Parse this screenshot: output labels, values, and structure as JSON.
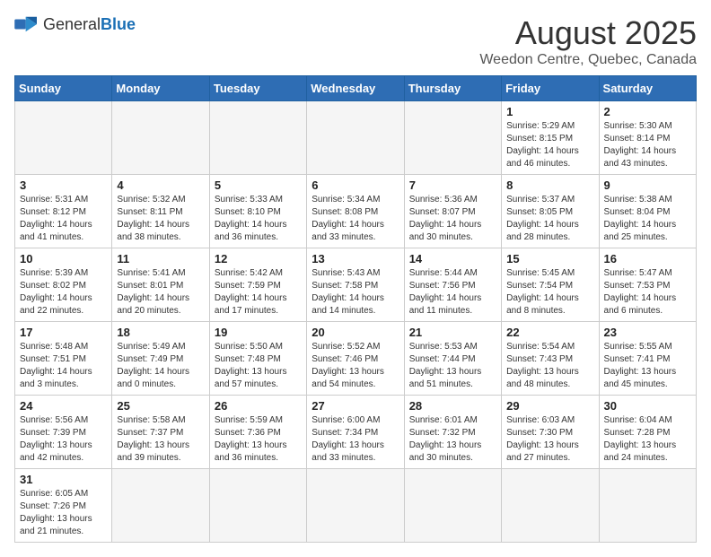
{
  "header": {
    "logo_text_general": "General",
    "logo_text_blue": "Blue",
    "month_title": "August 2025",
    "location": "Weedon Centre, Quebec, Canada"
  },
  "weekdays": [
    "Sunday",
    "Monday",
    "Tuesday",
    "Wednesday",
    "Thursday",
    "Friday",
    "Saturday"
  ],
  "weeks": [
    [
      {
        "day": "",
        "info": ""
      },
      {
        "day": "",
        "info": ""
      },
      {
        "day": "",
        "info": ""
      },
      {
        "day": "",
        "info": ""
      },
      {
        "day": "",
        "info": ""
      },
      {
        "day": "1",
        "info": "Sunrise: 5:29 AM\nSunset: 8:15 PM\nDaylight: 14 hours and 46 minutes."
      },
      {
        "day": "2",
        "info": "Sunrise: 5:30 AM\nSunset: 8:14 PM\nDaylight: 14 hours and 43 minutes."
      }
    ],
    [
      {
        "day": "3",
        "info": "Sunrise: 5:31 AM\nSunset: 8:12 PM\nDaylight: 14 hours and 41 minutes."
      },
      {
        "day": "4",
        "info": "Sunrise: 5:32 AM\nSunset: 8:11 PM\nDaylight: 14 hours and 38 minutes."
      },
      {
        "day": "5",
        "info": "Sunrise: 5:33 AM\nSunset: 8:10 PM\nDaylight: 14 hours and 36 minutes."
      },
      {
        "day": "6",
        "info": "Sunrise: 5:34 AM\nSunset: 8:08 PM\nDaylight: 14 hours and 33 minutes."
      },
      {
        "day": "7",
        "info": "Sunrise: 5:36 AM\nSunset: 8:07 PM\nDaylight: 14 hours and 30 minutes."
      },
      {
        "day": "8",
        "info": "Sunrise: 5:37 AM\nSunset: 8:05 PM\nDaylight: 14 hours and 28 minutes."
      },
      {
        "day": "9",
        "info": "Sunrise: 5:38 AM\nSunset: 8:04 PM\nDaylight: 14 hours and 25 minutes."
      }
    ],
    [
      {
        "day": "10",
        "info": "Sunrise: 5:39 AM\nSunset: 8:02 PM\nDaylight: 14 hours and 22 minutes."
      },
      {
        "day": "11",
        "info": "Sunrise: 5:41 AM\nSunset: 8:01 PM\nDaylight: 14 hours and 20 minutes."
      },
      {
        "day": "12",
        "info": "Sunrise: 5:42 AM\nSunset: 7:59 PM\nDaylight: 14 hours and 17 minutes."
      },
      {
        "day": "13",
        "info": "Sunrise: 5:43 AM\nSunset: 7:58 PM\nDaylight: 14 hours and 14 minutes."
      },
      {
        "day": "14",
        "info": "Sunrise: 5:44 AM\nSunset: 7:56 PM\nDaylight: 14 hours and 11 minutes."
      },
      {
        "day": "15",
        "info": "Sunrise: 5:45 AM\nSunset: 7:54 PM\nDaylight: 14 hours and 8 minutes."
      },
      {
        "day": "16",
        "info": "Sunrise: 5:47 AM\nSunset: 7:53 PM\nDaylight: 14 hours and 6 minutes."
      }
    ],
    [
      {
        "day": "17",
        "info": "Sunrise: 5:48 AM\nSunset: 7:51 PM\nDaylight: 14 hours and 3 minutes."
      },
      {
        "day": "18",
        "info": "Sunrise: 5:49 AM\nSunset: 7:49 PM\nDaylight: 14 hours and 0 minutes."
      },
      {
        "day": "19",
        "info": "Sunrise: 5:50 AM\nSunset: 7:48 PM\nDaylight: 13 hours and 57 minutes."
      },
      {
        "day": "20",
        "info": "Sunrise: 5:52 AM\nSunset: 7:46 PM\nDaylight: 13 hours and 54 minutes."
      },
      {
        "day": "21",
        "info": "Sunrise: 5:53 AM\nSunset: 7:44 PM\nDaylight: 13 hours and 51 minutes."
      },
      {
        "day": "22",
        "info": "Sunrise: 5:54 AM\nSunset: 7:43 PM\nDaylight: 13 hours and 48 minutes."
      },
      {
        "day": "23",
        "info": "Sunrise: 5:55 AM\nSunset: 7:41 PM\nDaylight: 13 hours and 45 minutes."
      }
    ],
    [
      {
        "day": "24",
        "info": "Sunrise: 5:56 AM\nSunset: 7:39 PM\nDaylight: 13 hours and 42 minutes."
      },
      {
        "day": "25",
        "info": "Sunrise: 5:58 AM\nSunset: 7:37 PM\nDaylight: 13 hours and 39 minutes."
      },
      {
        "day": "26",
        "info": "Sunrise: 5:59 AM\nSunset: 7:36 PM\nDaylight: 13 hours and 36 minutes."
      },
      {
        "day": "27",
        "info": "Sunrise: 6:00 AM\nSunset: 7:34 PM\nDaylight: 13 hours and 33 minutes."
      },
      {
        "day": "28",
        "info": "Sunrise: 6:01 AM\nSunset: 7:32 PM\nDaylight: 13 hours and 30 minutes."
      },
      {
        "day": "29",
        "info": "Sunrise: 6:03 AM\nSunset: 7:30 PM\nDaylight: 13 hours and 27 minutes."
      },
      {
        "day": "30",
        "info": "Sunrise: 6:04 AM\nSunset: 7:28 PM\nDaylight: 13 hours and 24 minutes."
      }
    ],
    [
      {
        "day": "31",
        "info": "Sunrise: 6:05 AM\nSunset: 7:26 PM\nDaylight: 13 hours and 21 minutes."
      },
      {
        "day": "",
        "info": ""
      },
      {
        "day": "",
        "info": ""
      },
      {
        "day": "",
        "info": ""
      },
      {
        "day": "",
        "info": ""
      },
      {
        "day": "",
        "info": ""
      },
      {
        "day": "",
        "info": ""
      }
    ]
  ]
}
